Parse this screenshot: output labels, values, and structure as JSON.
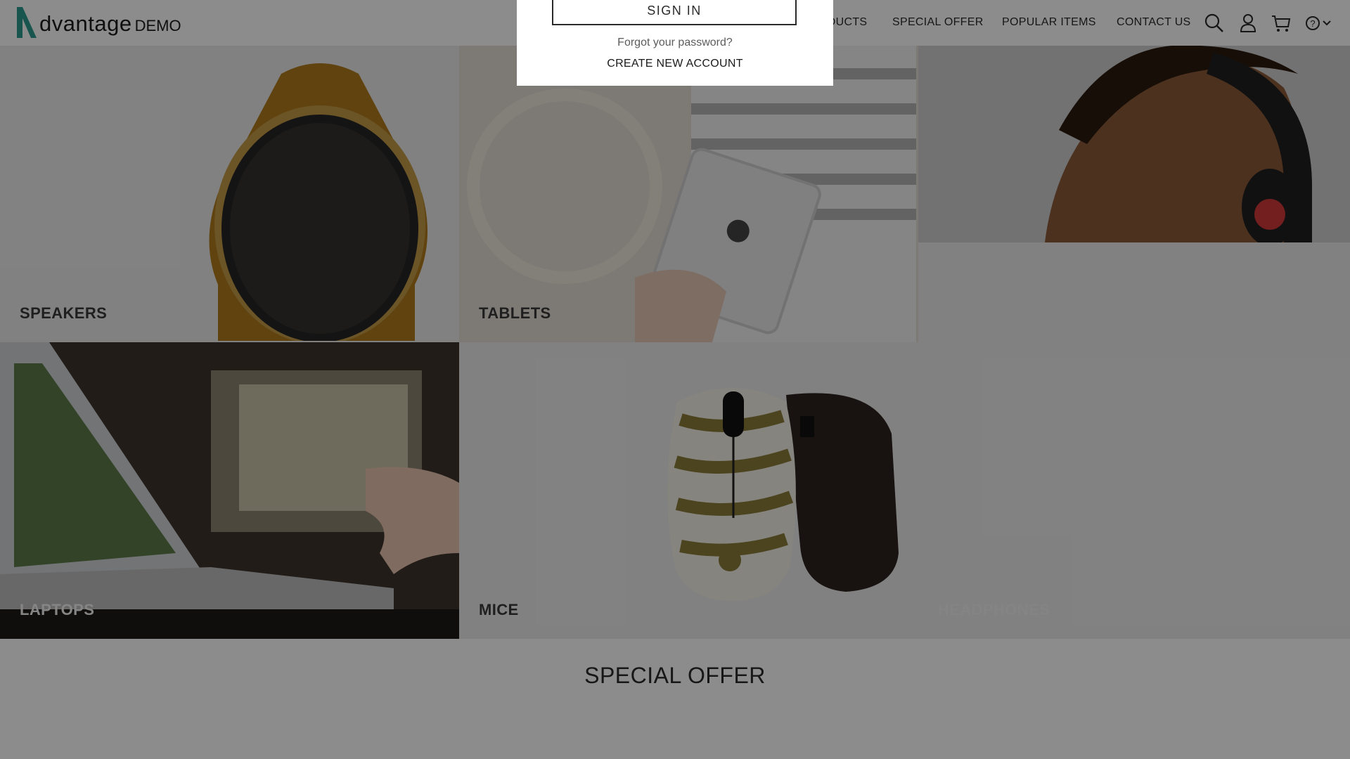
{
  "brand": {
    "name": "dvantage",
    "suffix": "DEMO",
    "accent": "#2d9b8f"
  },
  "nav": {
    "items": [
      "OUR PRODUCTS",
      "SPECIAL OFFER",
      "POPULAR ITEMS",
      "CONTACT US"
    ],
    "icons": [
      "search-icon",
      "user-icon",
      "cart-icon",
      "help-icon"
    ]
  },
  "tiles": {
    "speakers": "SPEAKERS",
    "tablets": "TABLETS",
    "laptops": "LAPTOPS",
    "mice": "MICE",
    "headphones": "HEADPHONES"
  },
  "sections": {
    "special_offer": "SPECIAL OFFER"
  },
  "login_popup": {
    "sign_in": "SIGN IN",
    "forgot_password": "Forgot your password?",
    "create_account": "CREATE NEW ACCOUNT"
  },
  "colors": {
    "overlay": "rgba(0,0,0,0.45)",
    "tile_bg": "#ececec"
  }
}
